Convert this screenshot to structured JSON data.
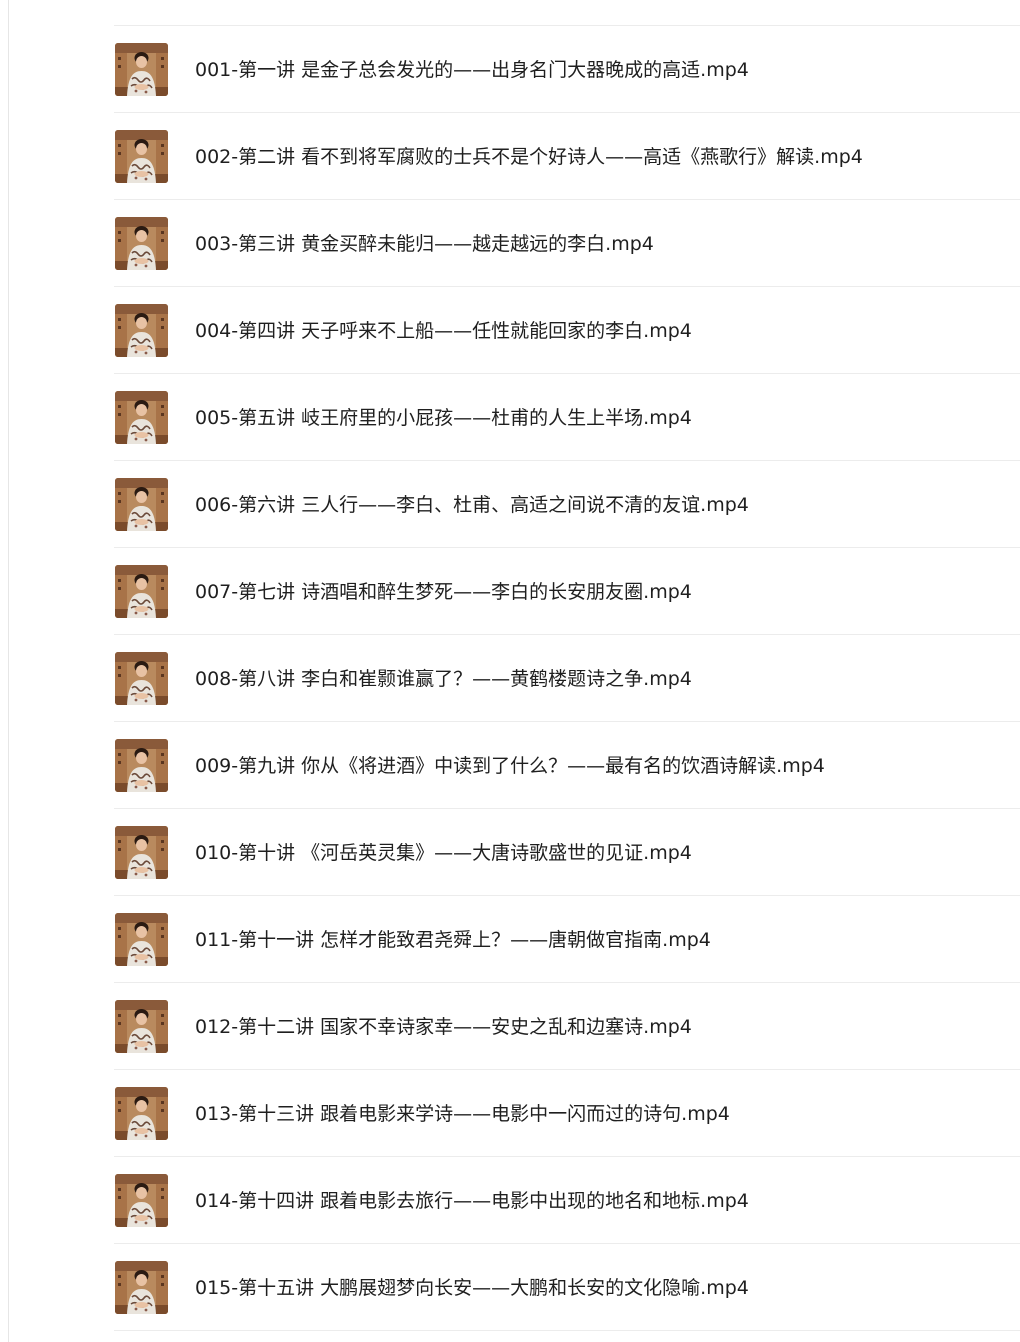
{
  "files": [
    {
      "name": "001-第一讲 是金子总会发光的——出身名门大器晚成的高适.mp4"
    },
    {
      "name": "002-第二讲 看不到将军腐败的士兵不是个好诗人——高适《燕歌行》解读.mp4"
    },
    {
      "name": "003-第三讲 黄金买醉未能归——越走越远的李白.mp4"
    },
    {
      "name": "004-第四讲 天子呼来不上船——任性就能回家的李白.mp4"
    },
    {
      "name": "005-第五讲 岐王府里的小屁孩——杜甫的人生上半场.mp4"
    },
    {
      "name": "006-第六讲 三人行——李白、杜甫、高适之间说不清的友谊.mp4"
    },
    {
      "name": "007-第七讲 诗酒唱和醉生梦死——李白的长安朋友圈.mp4"
    },
    {
      "name": "008-第八讲 李白和崔颢谁赢了？——黄鹤楼题诗之争.mp4"
    },
    {
      "name": "009-第九讲 你从《将进酒》中读到了什么？——最有名的饮酒诗解读.mp4"
    },
    {
      "name": "010-第十讲 《河岳英灵集》——大唐诗歌盛世的见证.mp4"
    },
    {
      "name": "011-第十一讲 怎样才能致君尧舜上？——唐朝做官指南.mp4"
    },
    {
      "name": "012-第十二讲 国家不幸诗家幸——安史之乱和边塞诗.mp4"
    },
    {
      "name": "013-第十三讲 跟着电影来学诗——电影中一闪而过的诗句.mp4"
    },
    {
      "name": "014-第十四讲 跟着电影去旅行——电影中出现的地名和地标.mp4"
    },
    {
      "name": "015-第十五讲 大鹏展翅梦向长安——大鹏和长安的文化隐喻.mp4"
    }
  ],
  "thumbnail_icon": "video-thumbnail",
  "colors": {
    "text": "#1f1f1f",
    "divider": "#ececec",
    "thumb_bg": "#c89a6c"
  }
}
